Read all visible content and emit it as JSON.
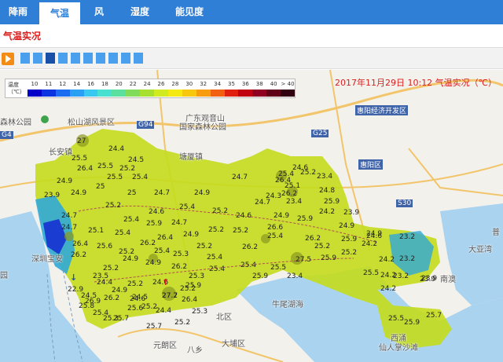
{
  "tabs": [
    {
      "label": "降雨",
      "active": false
    },
    {
      "label": "气温",
      "active": true
    },
    {
      "label": "风",
      "active": false
    },
    {
      "label": "湿度",
      "active": false
    },
    {
      "label": "能见度",
      "active": false
    }
  ],
  "subtitle": "气温实况",
  "timestamp": "2017年11月29日 10:12 气温实况（℃）",
  "legend": {
    "title_line1": "温度",
    "title_line2": "（℃）",
    "ticks": [
      "10",
      "11",
      "12",
      "14",
      "16",
      "18",
      "20",
      "22",
      "24",
      "26",
      "28",
      "30",
      "32",
      "34",
      "35",
      "36",
      "38",
      "40",
      "> 40"
    ],
    "colors": [
      "#0000c8",
      "#0a34e0",
      "#1a6cf0",
      "#2aa0f4",
      "#38c8f0",
      "#48e0d0",
      "#5ce0a0",
      "#80dc5a",
      "#a8e030",
      "#d0ec20",
      "#f4ea12",
      "#f8c810",
      "#f89c10",
      "#f06010",
      "#e02010",
      "#c00010",
      "#900020",
      "#600018",
      "#300010"
    ]
  },
  "places": [
    {
      "text": "森林公园"
    },
    {
      "text": "松山湖风景区"
    },
    {
      "text": "广东观音山"
    },
    {
      "text": "国家森林公园"
    },
    {
      "text": "长安镇"
    },
    {
      "text": "塘厦镇"
    },
    {
      "text": "凤岗镇"
    },
    {
      "text": "清溪镇"
    },
    {
      "text": "惠阳区"
    },
    {
      "text": "深圳宝安"
    },
    {
      "text": "南澳"
    },
    {
      "text": "大亚湾"
    },
    {
      "text": "北区"
    },
    {
      "text": "元朗区"
    },
    {
      "text": "大埔区"
    },
    {
      "text": "牛尾湖海"
    },
    {
      "text": "八乡"
    },
    {
      "text": "东莞"
    },
    {
      "text": "惠州"
    },
    {
      "text": "南澳"
    },
    {
      "text": "西涌"
    },
    {
      "text": "仙人掌沙滩"
    },
    {
      "text": "水库"
    },
    {
      "text": "路平"
    },
    {
      "text": "普"
    },
    {
      "text": "园"
    },
    {
      "text": "沙田镇"
    },
    {
      "text": "黄江"
    }
  ],
  "boxlabels": [
    {
      "text": "G94"
    },
    {
      "text": "G4"
    },
    {
      "text": "G25"
    },
    {
      "text": "S30"
    },
    {
      "text": "惠阳经济开发区"
    },
    {
      "text": "惠阳区"
    }
  ],
  "icons": [
    {
      "name": "park-icon"
    }
  ],
  "readings": [
    {
      "v": "27"
    },
    {
      "v": "24.4"
    },
    {
      "v": "25.5"
    },
    {
      "v": "24.5"
    },
    {
      "v": "25.5"
    },
    {
      "v": "25.2"
    },
    {
      "v": "26.4"
    },
    {
      "v": "25.5"
    },
    {
      "v": "24.9"
    },
    {
      "v": "25"
    },
    {
      "v": "25.4"
    },
    {
      "v": "23.9"
    },
    {
      "v": "24.9"
    },
    {
      "v": "25"
    },
    {
      "v": "24.7"
    },
    {
      "v": "24.9"
    },
    {
      "v": "25.2"
    },
    {
      "v": "24.7"
    },
    {
      "v": "24.6"
    },
    {
      "v": "25.4"
    },
    {
      "v": "25.2"
    },
    {
      "v": "24.7"
    },
    {
      "v": "25.4"
    },
    {
      "v": "25.9"
    },
    {
      "v": "24.7"
    },
    {
      "v": "25.1"
    },
    {
      "v": "25.4"
    },
    {
      "v": "24.9"
    },
    {
      "v": "26.4"
    },
    {
      "v": "25.6"
    },
    {
      "v": "26.4"
    },
    {
      "v": "26.2"
    },
    {
      "v": "25.2"
    },
    {
      "v": "25.2"
    },
    {
      "v": "26.2"
    },
    {
      "v": "24.9"
    },
    {
      "v": "25.3"
    },
    {
      "v": "24.9"
    },
    {
      "v": "25.2"
    },
    {
      "v": "26.2"
    },
    {
      "v": "25.4"
    },
    {
      "v": "25.4"
    },
    {
      "v": "25.3"
    },
    {
      "v": "24.4"
    },
    {
      "v": "25.2"
    },
    {
      "v": "24.6"
    },
    {
      "v": "25.9"
    },
    {
      "v": "25.9"
    },
    {
      "v": "27.5"
    },
    {
      "v": "25.9"
    },
    {
      "v": "25.5"
    },
    {
      "v": "25.4"
    },
    {
      "v": "23.4"
    },
    {
      "v": "25.2"
    },
    {
      "v": "24.2"
    },
    {
      "v": "26.2"
    },
    {
      "v": "24.5"
    },
    {
      "v": "26.2"
    },
    {
      "v": "24.6"
    },
    {
      "v": "26.4"
    },
    {
      "v": "25.6"
    },
    {
      "v": "25.3"
    },
    {
      "v": "25.4"
    },
    {
      "v": "25.7"
    },
    {
      "v": "24.6"
    },
    {
      "v": "25.4"
    },
    {
      "v": "24.3"
    },
    {
      "v": "24.7"
    },
    {
      "v": "25.2"
    },
    {
      "v": "23.4"
    },
    {
      "v": "24.8"
    },
    {
      "v": "25.9"
    },
    {
      "v": "24.2"
    },
    {
      "v": "23.4"
    },
    {
      "v": "24.9"
    },
    {
      "v": "25.9"
    },
    {
      "v": "23.9"
    },
    {
      "v": "26.6"
    },
    {
      "v": "24.6"
    },
    {
      "v": "25.2"
    },
    {
      "v": "24.9"
    },
    {
      "v": "24.6"
    },
    {
      "v": "25.9"
    },
    {
      "v": "25.3"
    },
    {
      "v": "24.4"
    },
    {
      "v": "25.8"
    },
    {
      "v": "27.2"
    },
    {
      "v": "25.2"
    },
    {
      "v": "25.2"
    },
    {
      "v": "23.5"
    },
    {
      "v": "24.7"
    },
    {
      "v": "26.2"
    },
    {
      "v": "25.1"
    },
    {
      "v": "26.4"
    },
    {
      "v": "26.2"
    },
    {
      "v": "25.2"
    },
    {
      "v": "22.9"
    },
    {
      "v": "26.9"
    },
    {
      "v": "24.9"
    },
    {
      "v": "24.2"
    },
    {
      "v": "25.4"
    },
    {
      "v": "25.2"
    },
    {
      "v": "27.7"
    },
    {
      "v": "25.4"
    },
    {
      "v": "23.9"
    },
    {
      "v": "23.2"
    },
    {
      "v": "24.2"
    },
    {
      "v": "23.2"
    },
    {
      "v": "24.9"
    },
    {
      "v": "25.5"
    },
    {
      "v": "23.2"
    },
    {
      "v": "24.2"
    },
    {
      "v": "23.9"
    },
    {
      "v": "25.5"
    },
    {
      "v": "25.7"
    },
    {
      "v": "25.9"
    },
    {
      "v": "24.5"
    },
    {
      "v": "25.7"
    },
    {
      "v": "25.2"
    }
  ],
  "colors": {
    "tabbar": "#2f7fd6",
    "warm_field": "#c4dc1c",
    "cool_field": "#30a8d8",
    "cold_core": "#1a3cd0",
    "sea": "#aad3ef",
    "land": "#f3f1ec"
  }
}
